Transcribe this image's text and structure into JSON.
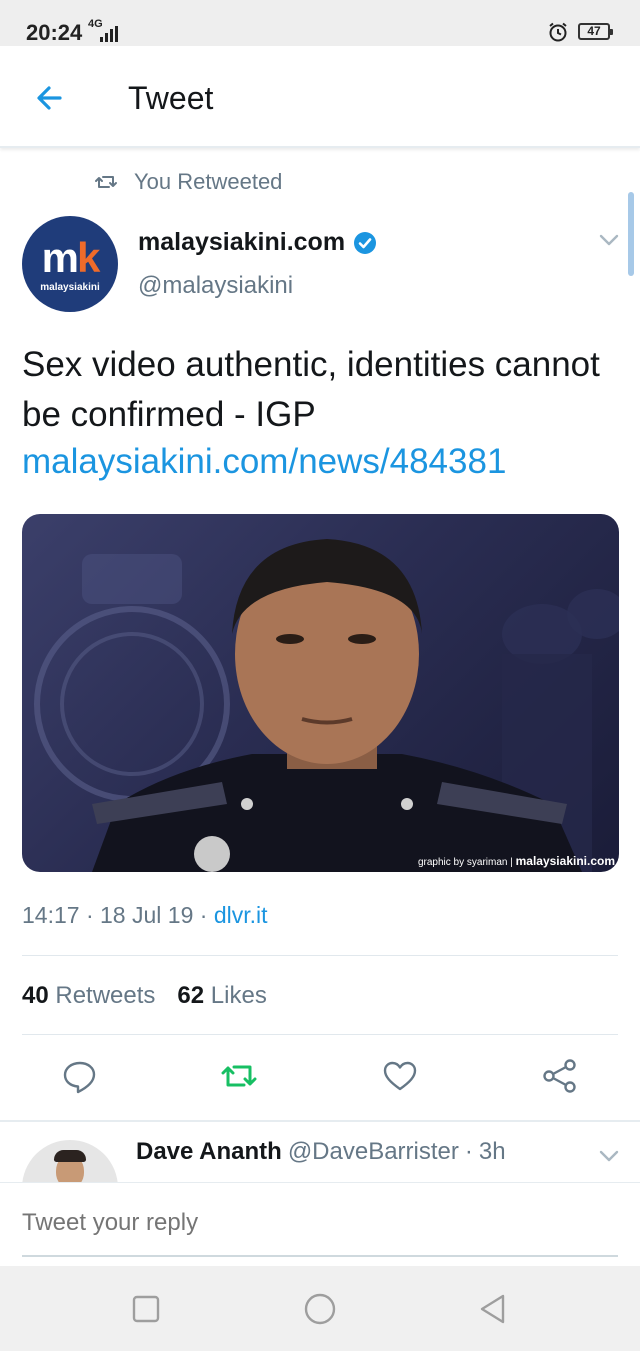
{
  "status_bar": {
    "time": "20:24",
    "network": "4G",
    "battery": "47",
    "icons": [
      "signal-icon",
      "alarm-icon",
      "battery-icon"
    ]
  },
  "app_bar": {
    "title": "Tweet",
    "back_icon": "arrow-left-icon"
  },
  "tweet": {
    "retweet_context": "You Retweeted",
    "author": {
      "name": "malaysiakini.com",
      "handle": "@malaysiakini",
      "verified": true,
      "avatar_text_m": "m",
      "avatar_text_k": "k",
      "avatar_subtitle": "malaysiakini"
    },
    "text": "Sex video authentic, identities cannot be confirmed - IGP",
    "link": "malaysiakini.com/news/484381",
    "media": {
      "credit_prefix": "graphic by syariman | ",
      "credit_brand": "malaysiakini.com"
    },
    "time": "14:17",
    "date": "18 Jul 19",
    "source": "dlvr.it",
    "sep": "·",
    "retweets_count": "40",
    "retweets_label": "Retweets",
    "likes_count": "62",
    "likes_label": "Likes"
  },
  "actions": [
    "reply-icon",
    "retweet-icon",
    "like-icon",
    "share-icon"
  ],
  "colors": {
    "accent": "#1b95e0",
    "retweeted": "#17bf63",
    "muted": "#657786",
    "text": "#14171a"
  },
  "reply": {
    "name": "Dave Ananth",
    "handle": "@DaveBarrister",
    "sep": "·",
    "age": "3h"
  },
  "composer": {
    "placeholder": "Tweet your reply"
  },
  "nav_bar": [
    "recents-icon",
    "home-icon",
    "back-icon"
  ]
}
